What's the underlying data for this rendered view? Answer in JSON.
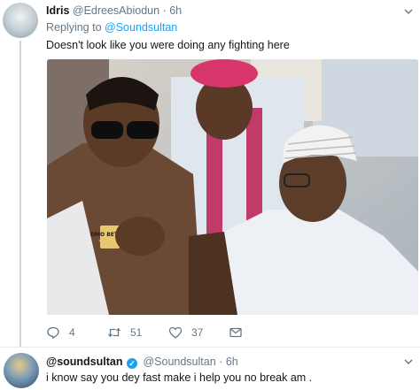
{
  "tweet": {
    "display_name": "Idris",
    "handle": "@EdreesAbiodun",
    "separator": "·",
    "time": "6h",
    "replying_label": "Replying to",
    "replying_handle": "@Soundsultan",
    "text": "Doesn't look like you were doing any fighting here",
    "photo_text": "DMO BETTER",
    "actions": {
      "reply_count": "4",
      "retweet_count": "51",
      "like_count": "37"
    }
  },
  "reply": {
    "display_name": "@soundsultan",
    "handle": "@Soundsultan",
    "separator": "·",
    "time": "6h",
    "text": "i know say you dey fast make i help you no break am ."
  },
  "icons": {
    "reply": "reply-icon",
    "retweet": "retweet-icon",
    "like": "heart-icon",
    "dm": "envelope-icon",
    "menu": "chevron-down-icon",
    "verified": "verified-badge-icon"
  },
  "colors": {
    "link": "#1da1f2",
    "muted": "#657786",
    "text": "#14171a",
    "divider": "#e6ecf0"
  }
}
